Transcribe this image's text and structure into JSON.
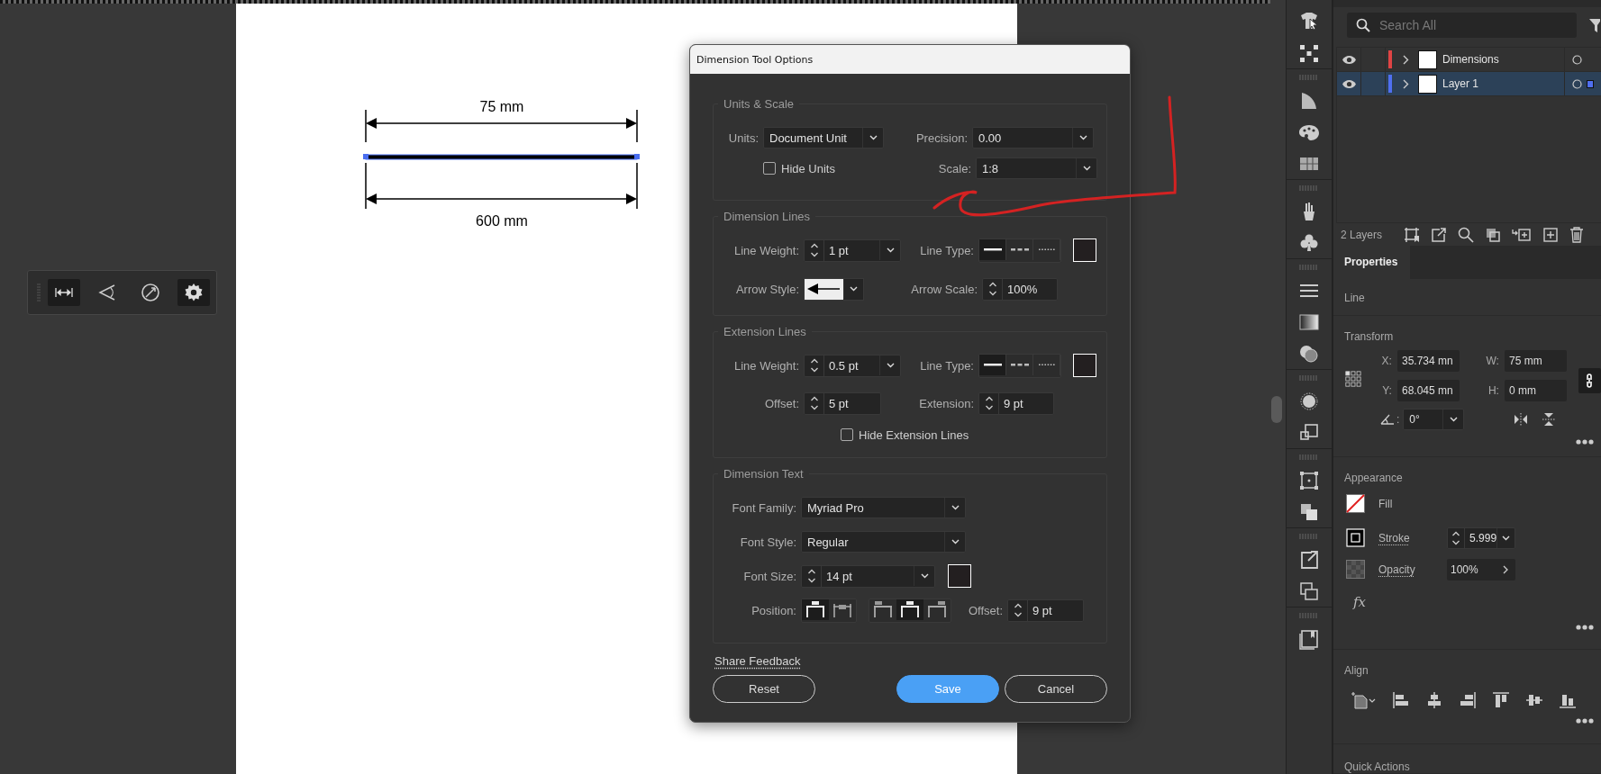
{
  "canvas": {
    "dimension_labels": [
      "75 mm",
      "600 mm"
    ]
  },
  "floating_toolbar": {
    "tools": [
      {
        "kind": "linear",
        "selected": true
      },
      {
        "kind": "angular",
        "selected": false
      },
      {
        "kind": "radial",
        "selected": false
      },
      {
        "kind": "settings",
        "selected": true
      }
    ]
  },
  "dialog": {
    "title": "Dimension Tool Options",
    "units_scale": {
      "title": "Units & Scale",
      "units": {
        "label": "Units:",
        "value": "Document Unit"
      },
      "precision": {
        "label": "Precision:",
        "value": "0.00"
      },
      "hide_units": {
        "label": "Hide Units",
        "checked": false
      },
      "scale": {
        "label": "Scale:",
        "value": "1:8"
      }
    },
    "dimension_lines": {
      "title": "Dimension Lines",
      "line_weight": {
        "label": "Line Weight:",
        "value": "1 pt"
      },
      "line_type": {
        "label": "Line Type:",
        "options": [
          {
            "kind": "solid",
            "selected": true
          },
          {
            "kind": "dashed",
            "selected": false
          },
          {
            "kind": "dotted",
            "selected": false
          }
        ]
      },
      "arrow_style": {
        "label": "Arrow Style:"
      },
      "arrow_scale": {
        "label": "Arrow Scale:",
        "value": "100%"
      }
    },
    "extension_lines": {
      "title": "Extension Lines",
      "line_weight": {
        "label": "Line Weight:",
        "value": "0.5 pt"
      },
      "line_type": {
        "label": "Line Type:",
        "options": [
          {
            "kind": "solid",
            "selected": true
          },
          {
            "kind": "dashed",
            "selected": false
          },
          {
            "kind": "dotted",
            "selected": false
          }
        ]
      },
      "offset": {
        "label": "Offset:",
        "value": "5 pt"
      },
      "extension": {
        "label": "Extension:",
        "value": "9 pt"
      },
      "hide_extension_lines": {
        "label": "Hide Extension Lines",
        "checked": false
      }
    },
    "dimension_text": {
      "title": "Dimension Text",
      "font_family": {
        "label": "Font Family:",
        "value": "Myriad Pro"
      },
      "font_style": {
        "label": "Font Style:",
        "value": "Regular"
      },
      "font_size": {
        "label": "Font Size:",
        "value": "14 pt"
      },
      "position": {
        "label": "Position:",
        "placement": [
          {
            "kind": "above",
            "selected": true
          },
          {
            "kind": "inline",
            "selected": false
          }
        ],
        "alignment": [
          {
            "kind": "left",
            "selected": false
          },
          {
            "kind": "center",
            "selected": true
          },
          {
            "kind": "right",
            "selected": false
          }
        ]
      },
      "offset": {
        "label": "Offset:",
        "value": "9 pt"
      }
    },
    "share_feedback": "Share Feedback",
    "buttons": [
      {
        "label": "Reset",
        "kind": "secondary"
      },
      {
        "label": "Save",
        "kind": "primary"
      },
      {
        "label": "Cancel",
        "kind": "secondary"
      }
    ]
  },
  "layers_panel": {
    "search": {
      "placeholder": "Search All"
    },
    "layers": [
      {
        "name": "Dimensions",
        "color": "#e04444",
        "visible": true,
        "selected": false
      },
      {
        "name": "Layer 1",
        "color": "#4f6ff0",
        "visible": true,
        "selected": true
      }
    ],
    "count": "2 Layers"
  },
  "properties": {
    "tab": "Properties",
    "object_type": "Line",
    "transform": {
      "title": "Transform",
      "fields": [
        {
          "label": "X:",
          "value": "35.734 mn"
        },
        {
          "label": "W:",
          "value": "75 mm"
        },
        {
          "label": "Y:",
          "value": "68.045 mn"
        },
        {
          "label": "H:",
          "value": "0 mm"
        }
      ],
      "angle_label": ":",
      "angle": "0°"
    },
    "appearance": {
      "title": "Appearance",
      "fill": "Fill",
      "stroke": {
        "label": "Stroke",
        "value": "5.999"
      },
      "opacity": {
        "label": "Opacity",
        "value": "100%"
      },
      "effects": "fx"
    },
    "align": {
      "title": "Align"
    },
    "quick_actions": {
      "title": "Quick Actions"
    }
  }
}
